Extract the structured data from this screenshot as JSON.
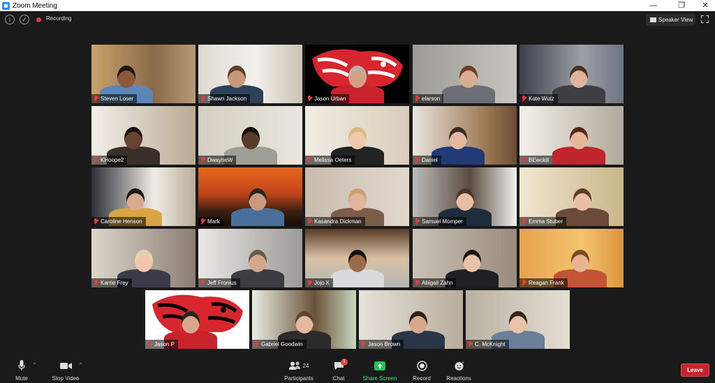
{
  "window": {
    "title": "Zoom Meeting",
    "minimize": "—",
    "maximize": "❐",
    "close": "✕"
  },
  "topbar": {
    "info_icon": "i",
    "shield_icon": "✓",
    "recording_label": "Recording",
    "view_label": "Speaker View"
  },
  "participants": [
    {
      "name": "Steven Loser"
    },
    {
      "name": "Shawn Jackson"
    },
    {
      "name": "Jason Urban"
    },
    {
      "name": "elarson"
    },
    {
      "name": "Kate Wutz"
    },
    {
      "name": "KHoope2"
    },
    {
      "name": "DwayneW"
    },
    {
      "name": "Melissa Oeters"
    },
    {
      "name": "Daniel"
    },
    {
      "name": "BEwoldt"
    },
    {
      "name": "Caroline Henson"
    },
    {
      "name": "Mark"
    },
    {
      "name": "Kasandra Dickman"
    },
    {
      "name": "Samuel Momper"
    },
    {
      "name": "Emma Stuber"
    },
    {
      "name": "Karrie Frey"
    },
    {
      "name": "Jeff Fronius"
    },
    {
      "name": "Jojo K"
    },
    {
      "name": "Abigail Zahn"
    },
    {
      "name": "Reagan Frank"
    },
    {
      "name": "Jason P"
    },
    {
      "name": "Gabriel Goodwin"
    },
    {
      "name": "Jason Brown"
    },
    {
      "name": "C. McKnight"
    }
  ],
  "toolbar": {
    "mute_label": "Mute",
    "video_label": "Stop Video",
    "participants_label": "Participants",
    "participants_count": "24",
    "chat_label": "Chat",
    "chat_badge": "1",
    "share_label": "Share Screen",
    "record_label": "Record",
    "reactions_label": "Reactions",
    "leave_label": "Leave",
    "caret": "^"
  },
  "colors": {
    "active_speaker": "#9be61a",
    "muted": "#e23d3d",
    "share": "#23c552",
    "leave": "#c4262e"
  }
}
